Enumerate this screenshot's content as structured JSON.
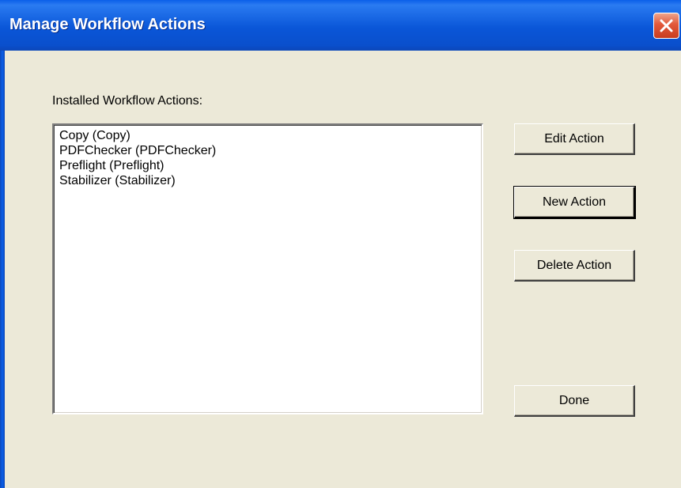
{
  "window": {
    "title": "Manage Workflow Actions"
  },
  "list": {
    "label": "Installed Workflow Actions:",
    "items": [
      "Copy (Copy)",
      "PDFChecker (PDFChecker)",
      "Preflight (Preflight)",
      "Stabilizer (Stabilizer)"
    ]
  },
  "buttons": {
    "edit": "Edit Action",
    "new": "New Action",
    "delete": "Delete Action",
    "done": "Done"
  },
  "icons": {
    "close": "close-icon"
  },
  "colors": {
    "titlebar": "#0a56d8",
    "background": "#ece9d8",
    "close_button": "#e2583a"
  }
}
